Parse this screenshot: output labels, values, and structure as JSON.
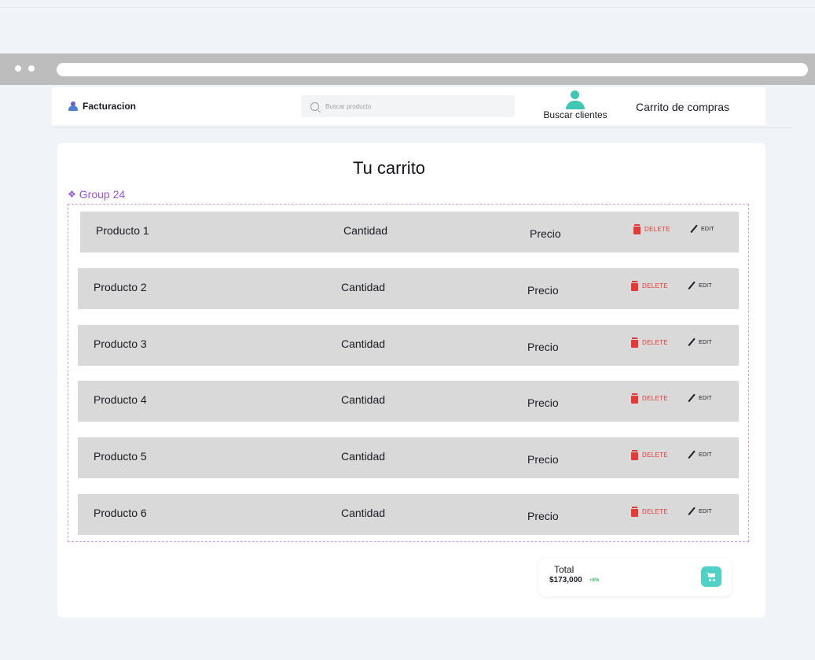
{
  "navbar": {
    "brand": "Facturacion",
    "search_placeholder": "Buscar producto",
    "clients_label": "Buscar clientes",
    "cart_link": "Carrito de compras"
  },
  "cart": {
    "title": "Tu carrito",
    "group_label": "Group 24",
    "rows": [
      {
        "product": "Producto 1",
        "quantity": "Cantidad",
        "price": "Precio",
        "delete_label": "DELETE",
        "edit_label": "EDIT"
      },
      {
        "product": "Producto 2",
        "quantity": "Cantidad",
        "price": "Precio",
        "delete_label": "DELETE",
        "edit_label": "EDIT"
      },
      {
        "product": "Producto 3",
        "quantity": "Cantidad",
        "price": "Precio",
        "delete_label": "DELETE",
        "edit_label": "EDIT"
      },
      {
        "product": "Producto 4",
        "quantity": "Cantidad",
        "price": "Precio",
        "delete_label": "DELETE",
        "edit_label": "EDIT"
      },
      {
        "product": "Producto 5",
        "quantity": "Cantidad",
        "price": "Precio",
        "delete_label": "DELETE",
        "edit_label": "EDIT"
      },
      {
        "product": "Producto 6",
        "quantity": "Cantidad",
        "price": "Precio",
        "delete_label": "DELETE",
        "edit_label": "EDIT"
      }
    ]
  },
  "total": {
    "label": "Total",
    "value": "$173,000",
    "change": "+8%"
  },
  "colors": {
    "accent_teal": "#4fd1c5",
    "delete_red": "#e53935",
    "group_purple": "#9b51e0",
    "change_green": "#43b56b"
  },
  "icons": [
    "brand-user-icon",
    "search-icon",
    "person-icon",
    "trash-icon",
    "pencil-icon",
    "cart-icon"
  ]
}
